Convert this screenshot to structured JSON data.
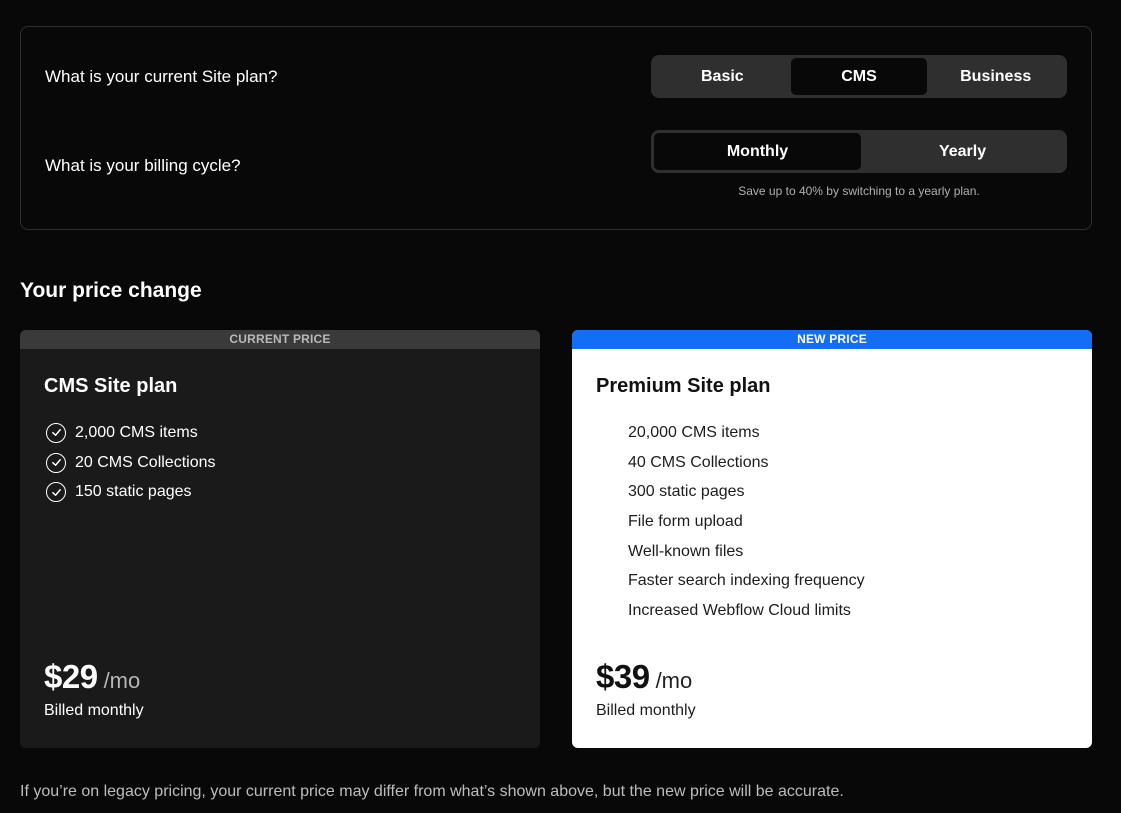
{
  "plan_question": "What is your current Site plan?",
  "plan_options": [
    "Basic",
    "CMS",
    "Business"
  ],
  "plan_selected": "CMS",
  "billing_question": "What is your billing cycle?",
  "billing_options": [
    "Monthly",
    "Yearly"
  ],
  "billing_selected": "Monthly",
  "billing_note": "Save up to 40% by switching to a yearly plan.",
  "section_title": "Your price change",
  "current": {
    "band_label": "CURRENT PRICE",
    "plan_name": "CMS Site plan",
    "features": [
      "2,000 CMS items",
      "20 CMS Collections",
      "150 static pages"
    ],
    "price": "$29",
    "unit": "/mo",
    "billing": "Billed monthly",
    "feature_icon": "check-circle-icon"
  },
  "new": {
    "band_label": "NEW PRICE",
    "plan_name": "Premium Site plan",
    "features": [
      "20,000 CMS items",
      "40 CMS Collections",
      "300 static pages",
      "File form upload",
      "Well-known files",
      "Faster search indexing frequency",
      "Increased Webflow Cloud limits"
    ],
    "price": "$39",
    "unit": "/mo",
    "billing": "Billed monthly"
  },
  "footnote": "If you’re on legacy pricing, your current price may differ from what’s shown above, but the new price will be accurate.",
  "colors": {
    "background": "#080808",
    "new_price_band": "#146ef5",
    "current_price_band": "#3a3a3a",
    "segment_bg": "#2f2f2f"
  }
}
